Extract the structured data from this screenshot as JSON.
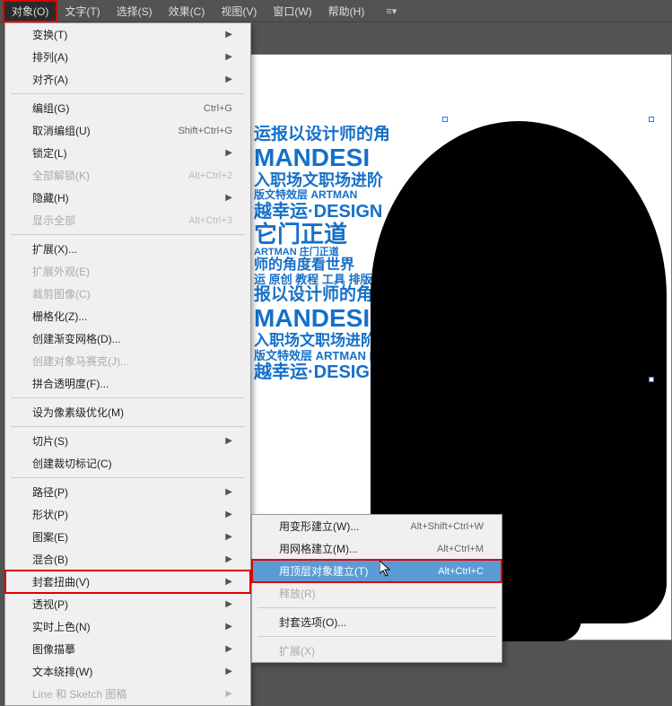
{
  "menubar": {
    "items": [
      {
        "label": "对象(O)",
        "active": true
      },
      {
        "label": "文字(T)"
      },
      {
        "label": "选择(S)"
      },
      {
        "label": "效果(C)"
      },
      {
        "label": "视图(V)"
      },
      {
        "label": "窗口(W)"
      },
      {
        "label": "帮助(H)"
      }
    ]
  },
  "menu1": {
    "items": [
      {
        "label": "变换(T)",
        "submenu": true
      },
      {
        "label": "排列(A)",
        "submenu": true
      },
      {
        "label": "对齐(A)",
        "submenu": true
      },
      {
        "sep": true
      },
      {
        "label": "编组(G)",
        "shortcut": "Ctrl+G"
      },
      {
        "label": "取消编组(U)",
        "shortcut": "Shift+Ctrl+G"
      },
      {
        "label": "锁定(L)",
        "submenu": true
      },
      {
        "label": "全部解锁(K)",
        "shortcut": "Alt+Ctrl+2",
        "disabled": true
      },
      {
        "label": "隐藏(H)",
        "submenu": true
      },
      {
        "label": "显示全部",
        "shortcut": "Alt+Ctrl+3",
        "disabled": true
      },
      {
        "sep": true
      },
      {
        "label": "扩展(X)..."
      },
      {
        "label": "扩展外观(E)",
        "disabled": true
      },
      {
        "label": "裁剪图像(C)",
        "disabled": true
      },
      {
        "label": "栅格化(Z)..."
      },
      {
        "label": "创建渐变网格(D)..."
      },
      {
        "label": "创建对象马赛克(J)...",
        "disabled": true
      },
      {
        "label": "拼合透明度(F)..."
      },
      {
        "sep": true
      },
      {
        "label": "设为像素级优化(M)"
      },
      {
        "sep": true
      },
      {
        "label": "切片(S)",
        "submenu": true
      },
      {
        "label": "创建裁切标记(C)"
      },
      {
        "sep": true
      },
      {
        "label": "路径(P)",
        "submenu": true
      },
      {
        "label": "形状(P)",
        "submenu": true
      },
      {
        "label": "图案(E)",
        "submenu": true
      },
      {
        "label": "混合(B)",
        "submenu": true
      },
      {
        "label": "封套扭曲(V)",
        "submenu": true,
        "highlight": true
      },
      {
        "label": "透视(P)",
        "submenu": true
      },
      {
        "label": "实时上色(N)",
        "submenu": true
      },
      {
        "label": "图像描摹",
        "submenu": true
      },
      {
        "label": "文本绕排(W)",
        "submenu": true
      },
      {
        "label": "Line 和 Sketch 图稿",
        "submenu": true,
        "disabled": true
      }
    ]
  },
  "menu2": {
    "items": [
      {
        "label": "用变形建立(W)...",
        "shortcut": "Alt+Shift+Ctrl+W"
      },
      {
        "label": "用网格建立(M)...",
        "shortcut": "Alt+Ctrl+M"
      },
      {
        "label": "用顶层对象建立(T)",
        "shortcut": "Alt+Ctrl+C",
        "highlighted": true
      },
      {
        "label": "释放(R)",
        "disabled": true
      },
      {
        "sep": true
      },
      {
        "label": "封套选项(O)..."
      },
      {
        "sep": true
      },
      {
        "label": "扩展(X)",
        "disabled": true
      }
    ]
  },
  "collage": {
    "lines": [
      {
        "t": "运报以设计师的角",
        "fs": 19
      },
      {
        "t": "MANDESI",
        "fs": 28
      },
      {
        "t": "入职场文职场进阶",
        "fs": 18
      },
      {
        "t": "版文特效层 ARTMAN",
        "fs": 12
      },
      {
        "t": "越幸运·DESIGN",
        "fs": 20
      },
      {
        "t": "它门正道",
        "fs": 26
      },
      {
        "t": "ARTMAN 庄门正道",
        "fs": 11
      },
      {
        "t": "师的角度看世界",
        "fs": 16
      },
      {
        "t": "运 原创 教程 工具 排版",
        "fs": 13
      },
      {
        "t": "报以设计师的角",
        "fs": 19
      },
      {
        "t": "MANDESI",
        "fs": 28
      },
      {
        "t": "入职场文职场进阶 庇",
        "fs": 17
      },
      {
        "t": "版文特效层 ARTMAN 门",
        "fs": 13
      },
      {
        "t": "越幸运·DESIGN",
        "fs": 20
      }
    ]
  }
}
